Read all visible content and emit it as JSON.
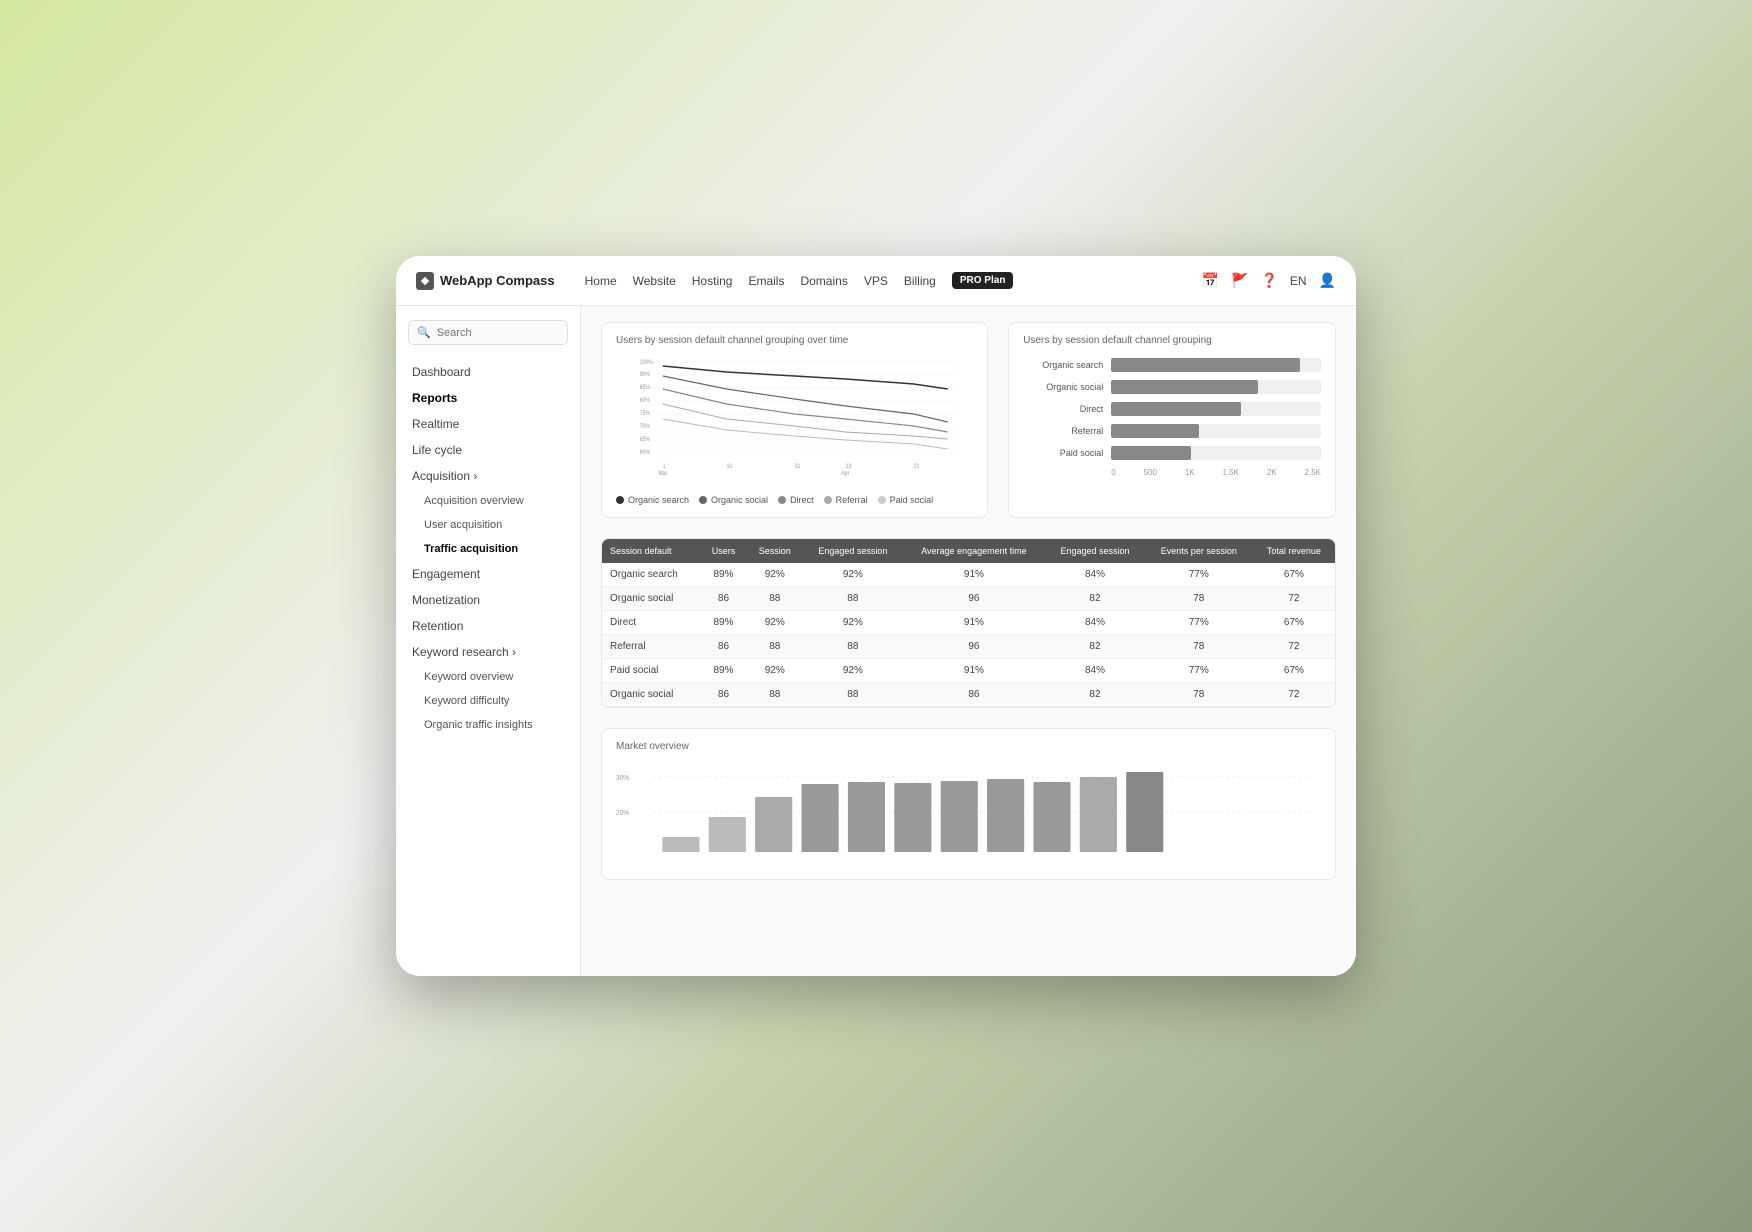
{
  "brand": {
    "name": "WebApp Compass",
    "icon": "W"
  },
  "nav": {
    "links": [
      "Home",
      "Website",
      "Hosting",
      "Emails",
      "Domains",
      "VPS",
      "Billing"
    ],
    "pro_label": "PRO Plan",
    "lang": "EN",
    "icons": [
      "calendar-icon",
      "flag-icon",
      "help-icon",
      "user-icon"
    ]
  },
  "sidebar": {
    "search_placeholder": "Search",
    "items": [
      {
        "label": "Dashboard",
        "active": false
      },
      {
        "label": "Reports",
        "active": true
      },
      {
        "label": "Realtime",
        "active": false
      },
      {
        "label": "Life cycle",
        "active": false
      },
      {
        "label": "Acquisition",
        "active": false,
        "hasArrow": true
      },
      {
        "label": "Acquisition overview",
        "sub": true
      },
      {
        "label": "User acquisition",
        "sub": true
      },
      {
        "label": "Traffic acquisition",
        "sub": true,
        "activeSub": true
      },
      {
        "label": "Engagement",
        "active": false
      },
      {
        "label": "Monetization",
        "active": false
      },
      {
        "label": "Retention",
        "active": false
      },
      {
        "label": "Keyword research",
        "active": false,
        "hasArrow": true
      },
      {
        "label": "Keyword overview",
        "sub": true
      },
      {
        "label": "Keyword difficulty",
        "sub": true
      },
      {
        "label": "Organic traffic insights",
        "sub": true
      }
    ]
  },
  "line_chart": {
    "title": "Users by session default channel grouping over time",
    "legend": [
      {
        "label": "Organic search",
        "color": "#333"
      },
      {
        "label": "Organic social",
        "color": "#666"
      },
      {
        "label": "Direct",
        "color": "#888"
      },
      {
        "label": "Referral",
        "color": "#aaa"
      },
      {
        "label": "Paid social",
        "color": "#ccc"
      }
    ],
    "x_labels": [
      "1\nMar",
      "10",
      "31",
      "13\nApr",
      "21"
    ],
    "y_labels": [
      "100%",
      "90%",
      "85%",
      "80%",
      "75%",
      "70%",
      "65%",
      "60%"
    ]
  },
  "bar_chart": {
    "title": "Users by session default channel grouping",
    "bars": [
      {
        "label": "Organic search",
        "value": 90
      },
      {
        "label": "Organic social",
        "value": 70
      },
      {
        "label": "Direct",
        "value": 62
      },
      {
        "label": "Referral",
        "value": 42
      },
      {
        "label": "Paid social",
        "value": 38
      }
    ],
    "x_axis": [
      "0",
      "500",
      "1K",
      "1.5K",
      "2K",
      "2.5K"
    ]
  },
  "table": {
    "headers": [
      "Session default",
      "Users",
      "Session",
      "Engaged session",
      "Average engagement time",
      "Engaged session",
      "Events per session",
      "Total revenue"
    ],
    "rows": [
      {
        "channel": "Organic search",
        "users": "89%",
        "session": "92%",
        "engaged": "92%",
        "avg_time": "91%",
        "eng_session": "84%",
        "events": "77%",
        "revenue": "67%"
      },
      {
        "channel": "Organic social",
        "users": "86",
        "session": "88",
        "engaged": "88",
        "avg_time": "96",
        "eng_session": "82",
        "events": "78",
        "revenue": "72"
      },
      {
        "channel": "Direct",
        "users": "89%",
        "session": "92%",
        "engaged": "92%",
        "avg_time": "91%",
        "eng_session": "84%",
        "events": "77%",
        "revenue": "67%"
      },
      {
        "channel": "Referral",
        "users": "86",
        "session": "88",
        "engaged": "88",
        "avg_time": "96",
        "eng_session": "82",
        "events": "78",
        "revenue": "72"
      },
      {
        "channel": "Paid social",
        "users": "89%",
        "session": "92%",
        "engaged": "92%",
        "avg_time": "91%",
        "eng_session": "84%",
        "events": "77%",
        "revenue": "67%"
      },
      {
        "channel": "Organic social",
        "users": "86",
        "session": "88",
        "engaged": "88",
        "avg_time": "86",
        "eng_session": "82",
        "events": "78",
        "revenue": "72"
      }
    ]
  },
  "market": {
    "title": "Market overview",
    "y_labels": [
      "30%",
      "20%"
    ],
    "bars": [
      15,
      35,
      55,
      65,
      68,
      67,
      68,
      70,
      69,
      72,
      75
    ]
  }
}
